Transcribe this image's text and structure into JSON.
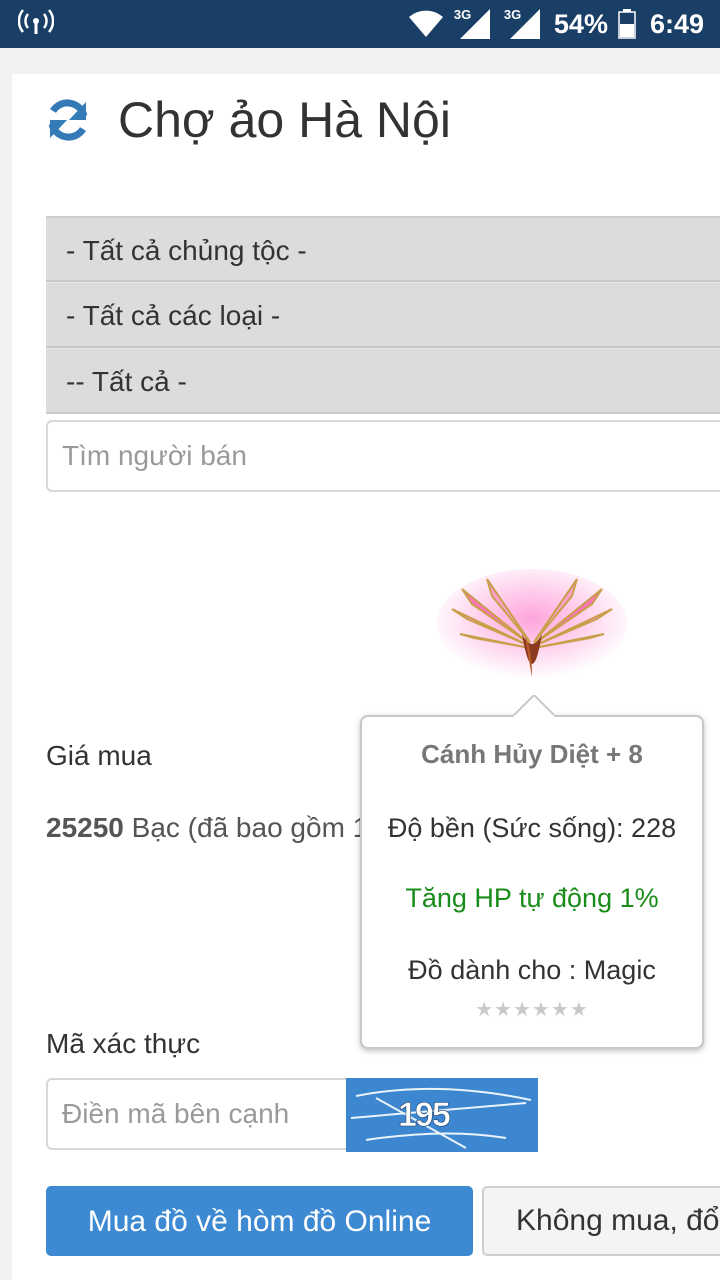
{
  "status_bar": {
    "network_1": "3G",
    "network_2": "3G",
    "battery": "54%",
    "time": "6:49",
    "icons": [
      "wireless-tower-icon",
      "wifi-icon",
      "signal-icon",
      "signal-icon",
      "battery-icon"
    ]
  },
  "header": {
    "title": "Chợ ảo Hà Nội",
    "icon": "refresh-icon",
    "accent_color": "#337ab7"
  },
  "filters": {
    "race": "- Tất cả chủng tộc -",
    "type": "- Tất cả các loại -",
    "subtype": "-- Tất cả -"
  },
  "seller_search": {
    "placeholder": "Tìm người bán",
    "value": ""
  },
  "item": {
    "name": "Cánh Hủy Diệt + 8",
    "durability": "Độ bền (Sức sống): 228",
    "bonus": "Tăng HP tự động 1%",
    "class_requirement": "Đồ dành cho : Magic",
    "stars": "★★★★★★",
    "bonus_color": "#1a8c1a"
  },
  "price": {
    "label": "Giá mua",
    "amount": "25250",
    "detail": " Bạc (đã bao gồm 1"
  },
  "captcha": {
    "label": "Mã xác thực",
    "placeholder": "Điền mã bên cạnh",
    "value": "",
    "image_text": "195"
  },
  "actions": {
    "buy_label": "Mua đồ về hòm đồ Online",
    "cancel_label": "Không mua, đổ",
    "buy_color": "#3d8ad2"
  }
}
